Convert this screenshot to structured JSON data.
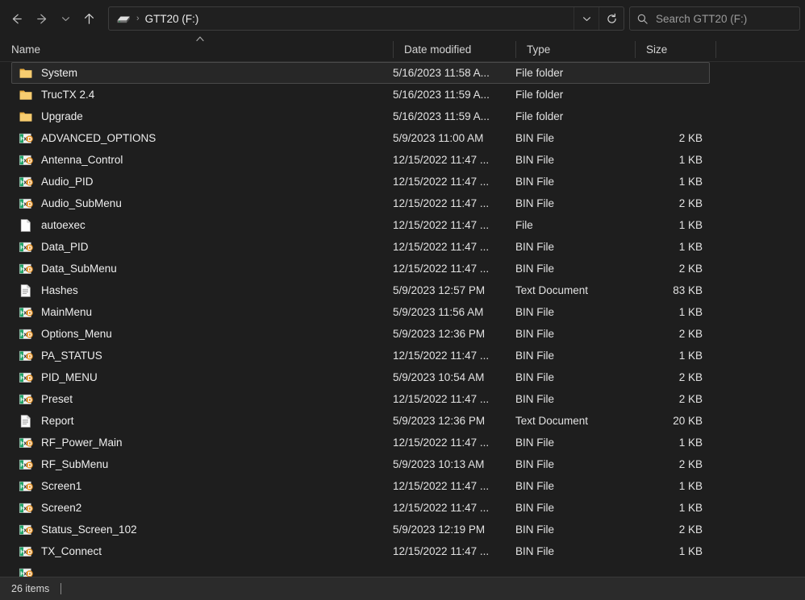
{
  "toolbar": {
    "back_label": "Back",
    "forward_label": "Forward",
    "recent_label": "Recent locations",
    "up_label": "Up to parent",
    "address_value": "GTT20 (F:)",
    "address_dropdown_label": "Previous locations",
    "refresh_label": "Refresh",
    "drive_icon": "usb-drive-icon",
    "separator": "›"
  },
  "search": {
    "placeholder": "Search GTT20 (F:)",
    "icon": "search-icon"
  },
  "columns": {
    "name": "Name",
    "date_modified": "Date modified",
    "type": "Type",
    "size": "Size",
    "sort_indicator": "∧"
  },
  "files": [
    {
      "name": "System",
      "date": "5/16/2023 11:58 A...",
      "type": "File folder",
      "size": "",
      "icon": "folder-icon",
      "selected": true
    },
    {
      "name": "TrucTX 2.4",
      "date": "5/16/2023 11:59 A...",
      "type": "File folder",
      "size": "",
      "icon": "folder-icon",
      "selected": false
    },
    {
      "name": "Upgrade",
      "date": "5/16/2023 11:59 A...",
      "type": "File folder",
      "size": "",
      "icon": "folder-icon",
      "selected": false
    },
    {
      "name": "ADVANCED_OPTIONS",
      "date": "5/9/2023 11:00 AM",
      "type": "BIN File",
      "size": "2 KB",
      "icon": "hxd-bin-icon",
      "selected": false
    },
    {
      "name": "Antenna_Control",
      "date": "12/15/2022 11:47 ...",
      "type": "BIN File",
      "size": "1 KB",
      "icon": "hxd-bin-icon",
      "selected": false
    },
    {
      "name": "Audio_PID",
      "date": "12/15/2022 11:47 ...",
      "type": "BIN File",
      "size": "1 KB",
      "icon": "hxd-bin-icon",
      "selected": false
    },
    {
      "name": "Audio_SubMenu",
      "date": "12/15/2022 11:47 ...",
      "type": "BIN File",
      "size": "2 KB",
      "icon": "hxd-bin-icon",
      "selected": false
    },
    {
      "name": "autoexec",
      "date": "12/15/2022 11:47 ...",
      "type": "File",
      "size": "1 KB",
      "icon": "blank-file-icon",
      "selected": false
    },
    {
      "name": "Data_PID",
      "date": "12/15/2022 11:47 ...",
      "type": "BIN File",
      "size": "1 KB",
      "icon": "hxd-bin-icon",
      "selected": false
    },
    {
      "name": "Data_SubMenu",
      "date": "12/15/2022 11:47 ...",
      "type": "BIN File",
      "size": "2 KB",
      "icon": "hxd-bin-icon",
      "selected": false
    },
    {
      "name": "Hashes",
      "date": "5/9/2023 12:57 PM",
      "type": "Text Document",
      "size": "83 KB",
      "icon": "text-document-icon",
      "selected": false
    },
    {
      "name": "MainMenu",
      "date": "5/9/2023 11:56 AM",
      "type": "BIN File",
      "size": "1 KB",
      "icon": "hxd-bin-icon",
      "selected": false
    },
    {
      "name": "Options_Menu",
      "date": "5/9/2023 12:36 PM",
      "type": "BIN File",
      "size": "2 KB",
      "icon": "hxd-bin-icon",
      "selected": false
    },
    {
      "name": "PA_STATUS",
      "date": "12/15/2022 11:47 ...",
      "type": "BIN File",
      "size": "1 KB",
      "icon": "hxd-bin-icon",
      "selected": false
    },
    {
      "name": "PID_MENU",
      "date": "5/9/2023 10:54 AM",
      "type": "BIN File",
      "size": "2 KB",
      "icon": "hxd-bin-icon",
      "selected": false
    },
    {
      "name": "Preset",
      "date": "12/15/2022 11:47 ...",
      "type": "BIN File",
      "size": "2 KB",
      "icon": "hxd-bin-icon",
      "selected": false
    },
    {
      "name": "Report",
      "date": "5/9/2023 12:36 PM",
      "type": "Text Document",
      "size": "20 KB",
      "icon": "text-document-icon",
      "selected": false
    },
    {
      "name": "RF_Power_Main",
      "date": "12/15/2022 11:47 ...",
      "type": "BIN File",
      "size": "1 KB",
      "icon": "hxd-bin-icon",
      "selected": false
    },
    {
      "name": "RF_SubMenu",
      "date": "5/9/2023 10:13 AM",
      "type": "BIN File",
      "size": "2 KB",
      "icon": "hxd-bin-icon",
      "selected": false
    },
    {
      "name": "Screen1",
      "date": "12/15/2022 11:47 ...",
      "type": "BIN File",
      "size": "1 KB",
      "icon": "hxd-bin-icon",
      "selected": false
    },
    {
      "name": "Screen2",
      "date": "12/15/2022 11:47 ...",
      "type": "BIN File",
      "size": "1 KB",
      "icon": "hxd-bin-icon",
      "selected": false
    },
    {
      "name": "Status_Screen_102",
      "date": "5/9/2023 12:19 PM",
      "type": "BIN File",
      "size": "2 KB",
      "icon": "hxd-bin-icon",
      "selected": false
    },
    {
      "name": "TX_Connect",
      "date": "12/15/2022 11:47 ...",
      "type": "BIN File",
      "size": "1 KB",
      "icon": "hxd-bin-icon",
      "selected": false
    },
    {
      "name": "",
      "date": "",
      "type": "",
      "size": "",
      "icon": "hxd-bin-icon",
      "selected": false
    }
  ],
  "statusbar": {
    "item_count": "26 items"
  },
  "colors": {
    "window_bg": "#1e1e1e",
    "statusbar_bg": "#2b2b2b",
    "selection_bg": "#272727",
    "selection_border": "#4a4a4a",
    "folder_yellow": "#f2c05a",
    "hxd_green": "#21a366",
    "hxd_orange": "#e8972d",
    "text_primary": "#eeeeee",
    "text_secondary": "#9b9b9b"
  }
}
